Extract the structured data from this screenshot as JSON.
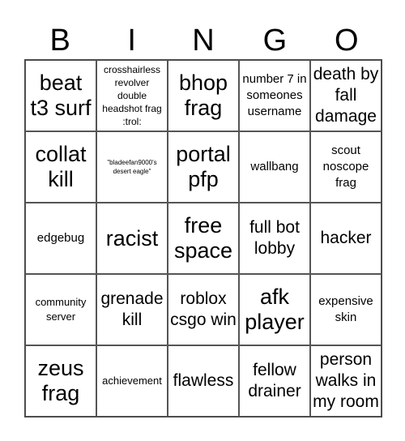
{
  "header": {
    "letters": [
      "B",
      "I",
      "N",
      "G",
      "O"
    ]
  },
  "cells": [
    {
      "text": "beat t3 surf",
      "size": "s-xl"
    },
    {
      "text": "crosshairless revolver double headshot frag :trol:",
      "size": "s-xs"
    },
    {
      "text": "bhop frag",
      "size": "s-xl"
    },
    {
      "text": "number 7 in someones username",
      "size": "s-m"
    },
    {
      "text": "death by fall damage",
      "size": "s-l"
    },
    {
      "text": "collat kill",
      "size": "s-xl"
    },
    {
      "text": "\"bladeefan9000's desert eagle\"",
      "size": "s-xxs"
    },
    {
      "text": "portal pfp",
      "size": "s-xl"
    },
    {
      "text": "wallbang",
      "size": "s-m"
    },
    {
      "text": "scout noscope frag",
      "size": "s-m"
    },
    {
      "text": "edgebug",
      "size": "s-m"
    },
    {
      "text": "racist",
      "size": "s-xl"
    },
    {
      "text": "free space",
      "size": "s-xl"
    },
    {
      "text": "full bot lobby",
      "size": "s-l"
    },
    {
      "text": "hacker",
      "size": "s-l"
    },
    {
      "text": "community server",
      "size": "s-s"
    },
    {
      "text": "grenade kill",
      "size": "s-l"
    },
    {
      "text": "roblox csgo win",
      "size": "s-l"
    },
    {
      "text": "afk player",
      "size": "s-xl"
    },
    {
      "text": "expensive skin",
      "size": "s-m"
    },
    {
      "text": "zeus frag",
      "size": "s-xl"
    },
    {
      "text": "achievement",
      "size": "s-s"
    },
    {
      "text": "flawless",
      "size": "s-l"
    },
    {
      "text": "fellow drainer",
      "size": "s-l"
    },
    {
      "text": "person walks in my room",
      "size": "s-l"
    }
  ]
}
